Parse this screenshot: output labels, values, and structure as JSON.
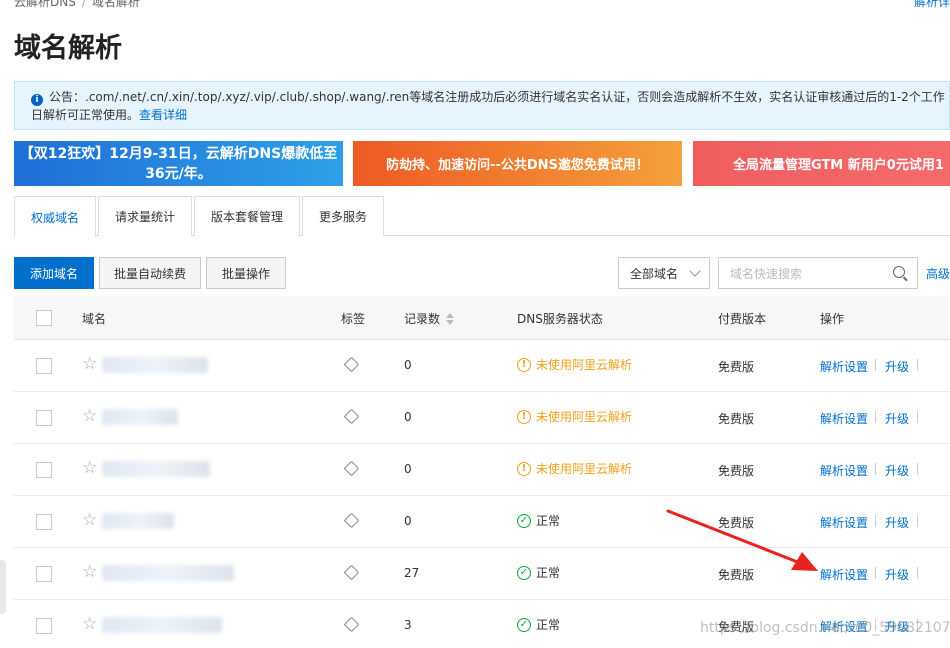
{
  "breadcrumb": {
    "root": "云解析DNS",
    "current": "域名解析"
  },
  "top_right_link": "解析详",
  "page_title": "域名解析",
  "notice": {
    "text": "公告：.com/.net/.cn/.xin/.top/.xyz/.vip/.club/.shop/.wang/.ren等域名注册成功后必须进行域名实名认证，否则会造成解析不生效，实名认证审核通过后的1-2个工作日解析可正常使用。",
    "link": "查看详细"
  },
  "banners": [
    {
      "text": "【双12狂欢】12月9-31日，云解析DNS爆款低至36元/年。",
      "color": "#1f6fd6"
    },
    {
      "text": "防劫持、加速访问--公共DNS邀您免费试用！",
      "color": "#ee5a24"
    },
    {
      "text": "全局流量管理GTM 新用户0元试用1",
      "color": "#f05d5d"
    }
  ],
  "tabs": [
    {
      "label": "权威域名",
      "active": true
    },
    {
      "label": "请求量统计",
      "active": false
    },
    {
      "label": "版本套餐管理",
      "active": false
    },
    {
      "label": "更多服务",
      "active": false
    }
  ],
  "toolbar": {
    "add_domain": "添加域名",
    "batch_renew": "批量自动续费",
    "batch_ops": "批量操作",
    "filter_value": "全部域名",
    "search_placeholder": "域名快速搜索",
    "advanced": "高级"
  },
  "table": {
    "headers": {
      "domain": "域名",
      "tag": "标签",
      "records": "记录数",
      "dns_status": "DNS服务器状态",
      "edition": "付费版本",
      "ops": "操作"
    },
    "rows": [
      {
        "records": "0",
        "status": "未使用阿里云解析",
        "status_type": "warn",
        "edition": "免费版",
        "op1": "解析设置",
        "op2": "升级"
      },
      {
        "records": "0",
        "status": "未使用阿里云解析",
        "status_type": "warn",
        "edition": "免费版",
        "op1": "解析设置",
        "op2": "升级"
      },
      {
        "records": "0",
        "status": "未使用阿里云解析",
        "status_type": "warn",
        "edition": "免费版",
        "op1": "解析设置",
        "op2": "升级"
      },
      {
        "records": "0",
        "status": "正常",
        "status_type": "ok",
        "edition": "免费版",
        "op1": "解析设置",
        "op2": "升级"
      },
      {
        "records": "27",
        "status": "正常",
        "status_type": "ok",
        "edition": "免费版",
        "op1": "解析设置",
        "op2": "升级"
      },
      {
        "records": "3",
        "status": "正常",
        "status_type": "ok",
        "edition": "免费版",
        "op1": "解析设置",
        "op2": "升级"
      }
    ]
  },
  "watermark": "https://blog.csdn.net/m0_59082107",
  "colors": {
    "accent": "#0070cc",
    "warn": "#f0a21d",
    "ok": "#14a33a",
    "annotation_arrow": "#e8231f"
  }
}
